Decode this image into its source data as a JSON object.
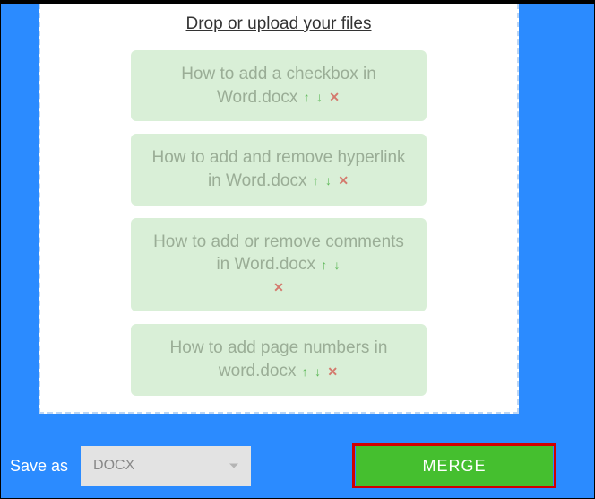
{
  "dropzone": {
    "title": "Drop or upload your files"
  },
  "files": [
    {
      "name": "How to add a checkbox in Word.docx"
    },
    {
      "name": "How to add and remove hyperlink in Word.docx"
    },
    {
      "name": "How to add or remove comments in Word.docx"
    },
    {
      "name": "How to add page numbers in word.docx"
    }
  ],
  "footer": {
    "save_as_label": "Save as",
    "format": "DOCX",
    "merge_label": "MERGE"
  },
  "icons": {
    "up": "↑",
    "down": "↓",
    "delete": "✕"
  }
}
